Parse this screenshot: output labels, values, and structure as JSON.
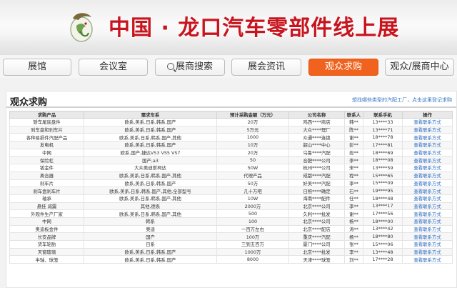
{
  "banner": {
    "title": "中国 · 龙口汽车零部件线上展"
  },
  "nav": {
    "tabs": [
      {
        "label": "展馆",
        "active": false
      },
      {
        "label": "会议室",
        "active": false
      },
      {
        "label": "展商搜索",
        "active": false,
        "icon": "search-icon"
      },
      {
        "label": "展会资讯",
        "active": false
      },
      {
        "label": "观众求购",
        "active": true
      },
      {
        "label": "观众/展商中心",
        "active": false
      }
    ]
  },
  "section": {
    "title": "观众求购",
    "link": "想找哪些类型的汽配工厂，点击这里登记求购"
  },
  "table": {
    "headers": [
      "求购产品",
      "需求车系",
      "预计采购金额（万元）",
      "公司名称",
      "联系人",
      "联系手机",
      "操作"
    ],
    "rows": [
      [
        "轿车尾底盘件",
        "欧系,美系,日系,韩系,国产",
        "20万",
        "鸡西****商店",
        "韩**",
        "13****33",
        "查看联系方式"
      ],
      [
        "刹车盘和刹车片",
        "欧系,美系,日系,韩系,国产",
        "5万元",
        "大众****理厂",
        "陈**",
        "13****71",
        "查看联系方式"
      ],
      [
        "各种易损件汽配产品",
        "欧系,美系,日系,韩系,国产,其他",
        "1000",
        "众通****连锁",
        "谢**",
        "18****78",
        "查看联系方式"
      ],
      [
        "发电机",
        "欧系,美系,日系,韩系,国产",
        "10万",
        "韶山****中心",
        "彭**",
        "17****81",
        "查看联系方式"
      ],
      [
        "中网",
        "欧系,国产,捷达VS3 VS5 VS7",
        "20万",
        "乌鲁****汽配",
        "段**",
        "18****69",
        "查看联系方式"
      ],
      [
        "保险杠",
        "国产,a3",
        "50",
        "合肥****公司",
        "李**",
        "18****08",
        "查看联系方式"
      ],
      [
        "钣金件",
        "大众奥迪斯柯达",
        "50W",
        "杭州****公司",
        "宋**",
        "13****59",
        "查看联系方式"
      ],
      [
        "离合器",
        "欧系,美系,日系,韩系,国产,其他",
        "代理产品",
        "成都****汽配",
        "程**",
        "15****65",
        "查看联系方式"
      ],
      [
        "刹车片",
        "欧系,美系,日系,韩系,国产",
        "50万",
        "好美****汽配",
        "李**",
        "15****09",
        "查看联系方式"
      ],
      [
        "刹车盘刹车片",
        "欧系,美系,日系,韩系,国产,其他,全部型号",
        "几十万吧",
        "日照****确定",
        "石**",
        "19****95",
        "查看联系方式"
      ],
      [
        "轴承",
        "欧系,美系,日系,韩系,国产,其他",
        "10W",
        "海南****配件",
        "任**",
        "18****48",
        "查看联系方式"
      ],
      [
        "悬挂 减震",
        "其他,德系",
        "2000万",
        "北京****公司",
        "李**",
        "13****17",
        "查看联系方式"
      ],
      [
        "外观件生产厂家",
        "欧系,美系,日系,韩系,国产,其他",
        "500",
        "久利****批发",
        "谢**",
        "17****56",
        "查看联系方式"
      ],
      [
        "中网",
        "韩系",
        "100",
        "北京****公司",
        "杨**",
        "18****00",
        "查看联系方式"
      ],
      [
        "奥迪板金件",
        "奥迪",
        "一百万左右",
        "北京****配店",
        "涛**",
        "13****42",
        "查看联系方式"
      ],
      [
        "长安品牌",
        "国产",
        "100万",
        "重庆****汽配",
        "杨**",
        "18****80",
        "查看联系方式"
      ],
      [
        "货车轮胎",
        "日系",
        "三到五百万",
        "厦门****公司",
        "张**",
        "15****06",
        "查看联系方式"
      ],
      [
        "天窗玻璃",
        "欧系,美系,日系,韩系,国产",
        "1000万",
        "北京****批发",
        "李**",
        "13****48",
        "查看联系方式"
      ],
      [
        "半轴、球笼",
        "欧系,美系,日系,韩系,国产",
        "8000",
        "天津****球笼",
        "刘**",
        "17****28",
        "查看联系方式"
      ]
    ]
  }
}
